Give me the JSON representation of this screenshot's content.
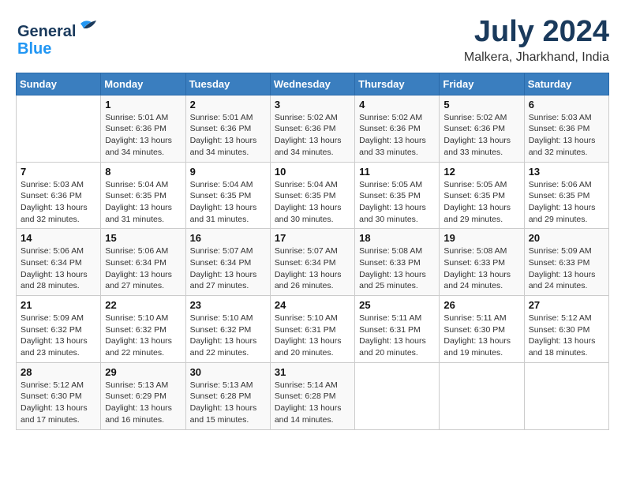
{
  "logo": {
    "line1": "General",
    "line2": "Blue"
  },
  "title": "July 2024",
  "subtitle": "Malkera, Jharkhand, India",
  "days_of_week": [
    "Sunday",
    "Monday",
    "Tuesday",
    "Wednesday",
    "Thursday",
    "Friday",
    "Saturday"
  ],
  "weeks": [
    [
      {
        "day": "",
        "info": ""
      },
      {
        "day": "1",
        "info": "Sunrise: 5:01 AM\nSunset: 6:36 PM\nDaylight: 13 hours\nand 34 minutes."
      },
      {
        "day": "2",
        "info": "Sunrise: 5:01 AM\nSunset: 6:36 PM\nDaylight: 13 hours\nand 34 minutes."
      },
      {
        "day": "3",
        "info": "Sunrise: 5:02 AM\nSunset: 6:36 PM\nDaylight: 13 hours\nand 34 minutes."
      },
      {
        "day": "4",
        "info": "Sunrise: 5:02 AM\nSunset: 6:36 PM\nDaylight: 13 hours\nand 33 minutes."
      },
      {
        "day": "5",
        "info": "Sunrise: 5:02 AM\nSunset: 6:36 PM\nDaylight: 13 hours\nand 33 minutes."
      },
      {
        "day": "6",
        "info": "Sunrise: 5:03 AM\nSunset: 6:36 PM\nDaylight: 13 hours\nand 32 minutes."
      }
    ],
    [
      {
        "day": "7",
        "info": "Sunrise: 5:03 AM\nSunset: 6:36 PM\nDaylight: 13 hours\nand 32 minutes."
      },
      {
        "day": "8",
        "info": "Sunrise: 5:04 AM\nSunset: 6:35 PM\nDaylight: 13 hours\nand 31 minutes."
      },
      {
        "day": "9",
        "info": "Sunrise: 5:04 AM\nSunset: 6:35 PM\nDaylight: 13 hours\nand 31 minutes."
      },
      {
        "day": "10",
        "info": "Sunrise: 5:04 AM\nSunset: 6:35 PM\nDaylight: 13 hours\nand 30 minutes."
      },
      {
        "day": "11",
        "info": "Sunrise: 5:05 AM\nSunset: 6:35 PM\nDaylight: 13 hours\nand 30 minutes."
      },
      {
        "day": "12",
        "info": "Sunrise: 5:05 AM\nSunset: 6:35 PM\nDaylight: 13 hours\nand 29 minutes."
      },
      {
        "day": "13",
        "info": "Sunrise: 5:06 AM\nSunset: 6:35 PM\nDaylight: 13 hours\nand 29 minutes."
      }
    ],
    [
      {
        "day": "14",
        "info": "Sunrise: 5:06 AM\nSunset: 6:34 PM\nDaylight: 13 hours\nand 28 minutes."
      },
      {
        "day": "15",
        "info": "Sunrise: 5:06 AM\nSunset: 6:34 PM\nDaylight: 13 hours\nand 27 minutes."
      },
      {
        "day": "16",
        "info": "Sunrise: 5:07 AM\nSunset: 6:34 PM\nDaylight: 13 hours\nand 27 minutes."
      },
      {
        "day": "17",
        "info": "Sunrise: 5:07 AM\nSunset: 6:34 PM\nDaylight: 13 hours\nand 26 minutes."
      },
      {
        "day": "18",
        "info": "Sunrise: 5:08 AM\nSunset: 6:33 PM\nDaylight: 13 hours\nand 25 minutes."
      },
      {
        "day": "19",
        "info": "Sunrise: 5:08 AM\nSunset: 6:33 PM\nDaylight: 13 hours\nand 24 minutes."
      },
      {
        "day": "20",
        "info": "Sunrise: 5:09 AM\nSunset: 6:33 PM\nDaylight: 13 hours\nand 24 minutes."
      }
    ],
    [
      {
        "day": "21",
        "info": "Sunrise: 5:09 AM\nSunset: 6:32 PM\nDaylight: 13 hours\nand 23 minutes."
      },
      {
        "day": "22",
        "info": "Sunrise: 5:10 AM\nSunset: 6:32 PM\nDaylight: 13 hours\nand 22 minutes."
      },
      {
        "day": "23",
        "info": "Sunrise: 5:10 AM\nSunset: 6:32 PM\nDaylight: 13 hours\nand 22 minutes."
      },
      {
        "day": "24",
        "info": "Sunrise: 5:10 AM\nSunset: 6:31 PM\nDaylight: 13 hours\nand 20 minutes."
      },
      {
        "day": "25",
        "info": "Sunrise: 5:11 AM\nSunset: 6:31 PM\nDaylight: 13 hours\nand 20 minutes."
      },
      {
        "day": "26",
        "info": "Sunrise: 5:11 AM\nSunset: 6:30 PM\nDaylight: 13 hours\nand 19 minutes."
      },
      {
        "day": "27",
        "info": "Sunrise: 5:12 AM\nSunset: 6:30 PM\nDaylight: 13 hours\nand 18 minutes."
      }
    ],
    [
      {
        "day": "28",
        "info": "Sunrise: 5:12 AM\nSunset: 6:30 PM\nDaylight: 13 hours\nand 17 minutes."
      },
      {
        "day": "29",
        "info": "Sunrise: 5:13 AM\nSunset: 6:29 PM\nDaylight: 13 hours\nand 16 minutes."
      },
      {
        "day": "30",
        "info": "Sunrise: 5:13 AM\nSunset: 6:28 PM\nDaylight: 13 hours\nand 15 minutes."
      },
      {
        "day": "31",
        "info": "Sunrise: 5:14 AM\nSunset: 6:28 PM\nDaylight: 13 hours\nand 14 minutes."
      },
      {
        "day": "",
        "info": ""
      },
      {
        "day": "",
        "info": ""
      },
      {
        "day": "",
        "info": ""
      }
    ]
  ]
}
